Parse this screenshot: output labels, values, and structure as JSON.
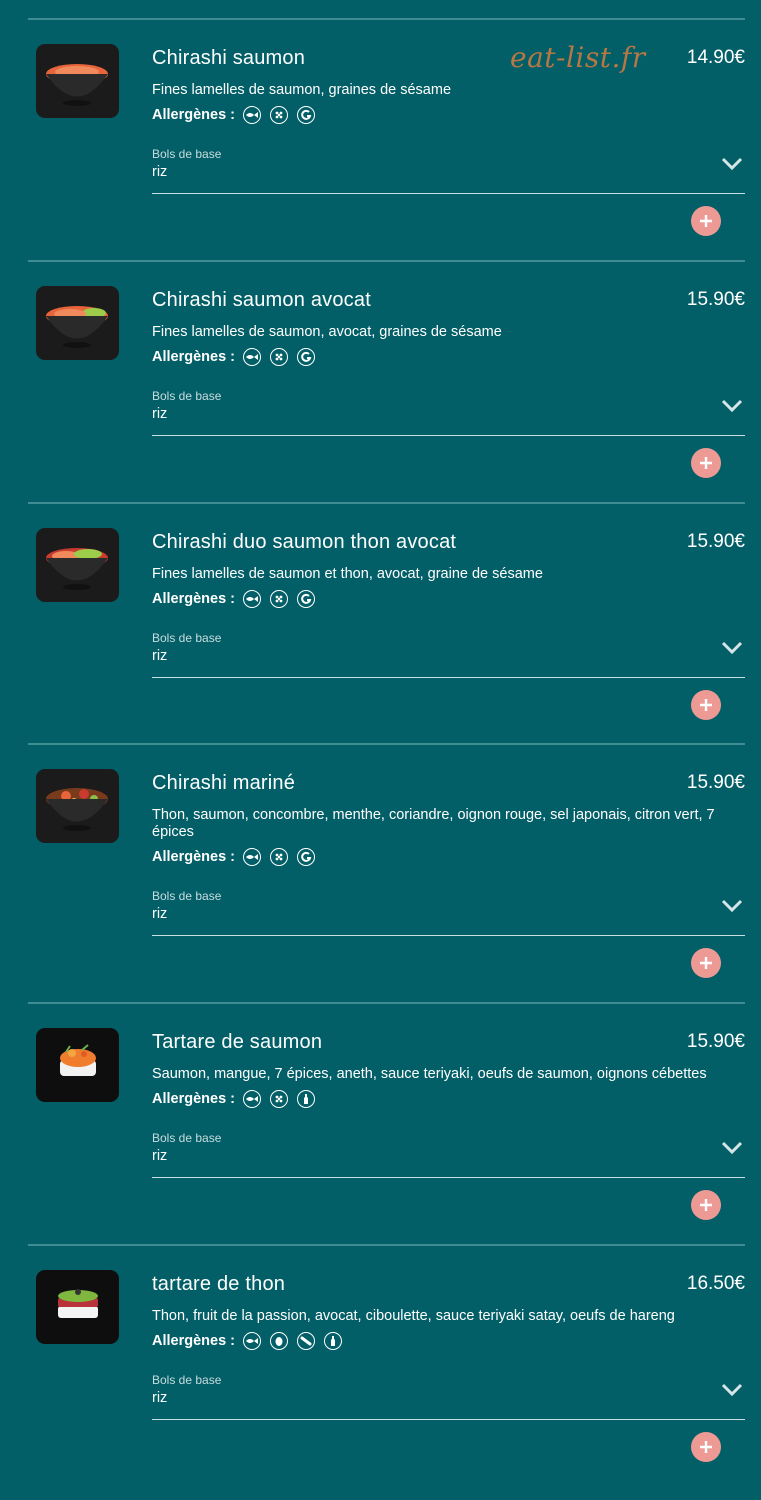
{
  "watermark": "eat-list.fr",
  "labels": {
    "allergens": "Allergènes :",
    "base": "Bols de base"
  },
  "colors": {
    "background": "#035f67",
    "add_button": "#ee9a94",
    "divider": "#3f8c93",
    "watermark": "#b77745"
  },
  "items": [
    {
      "name": "Chirashi saumon",
      "price": "14.90€",
      "description": "Fines lamelles de saumon, graines de sésame",
      "allergens": [
        "fish-icon",
        "sesame-icon",
        "gluten-icon"
      ],
      "base_value": "riz",
      "image": "bowl-salmon-icon"
    },
    {
      "name": "Chirashi saumon avocat",
      "price": "15.90€",
      "description": "Fines lamelles de saumon, avocat, graines de sésame",
      "allergens": [
        "fish-icon",
        "sesame-icon",
        "gluten-icon"
      ],
      "base_value": "riz",
      "image": "bowl-salmon-avocado-icon"
    },
    {
      "name": "Chirashi duo saumon thon avocat",
      "price": "15.90€",
      "description": "Fines lamelles de saumon et thon, avocat, graine de sésame",
      "allergens": [
        "fish-icon",
        "sesame-icon",
        "gluten-icon"
      ],
      "base_value": "riz",
      "image": "bowl-salmon-tuna-icon"
    },
    {
      "name": "Chirashi mariné",
      "price": "15.90€",
      "description": "Thon, saumon, concombre, menthe, coriandre, oignon rouge, sel japonais, citron vert, 7 épices",
      "allergens": [
        "fish-icon",
        "sesame-icon",
        "gluten-icon"
      ],
      "base_value": "riz",
      "image": "bowl-marinated-icon"
    },
    {
      "name": "Tartare de saumon",
      "price": "15.90€",
      "description": "Saumon, mangue, 7 épices, aneth, sauce teriyaki, oeufs de saumon, oignons cébettes",
      "allergens": [
        "fish-icon",
        "sesame-icon",
        "soy-icon"
      ],
      "base_value": "riz",
      "image": "tartare-salmon-icon"
    },
    {
      "name": "tartare de thon",
      "price": "16.50€",
      "description": "Thon, fruit de la passion, avocat, ciboulette, sauce teriyaki satay, oeufs de hareng",
      "allergens": [
        "fish-icon",
        "egg-icon",
        "peanut-icon",
        "soy-icon"
      ],
      "base_value": "riz",
      "image": "tartare-tuna-icon"
    }
  ]
}
